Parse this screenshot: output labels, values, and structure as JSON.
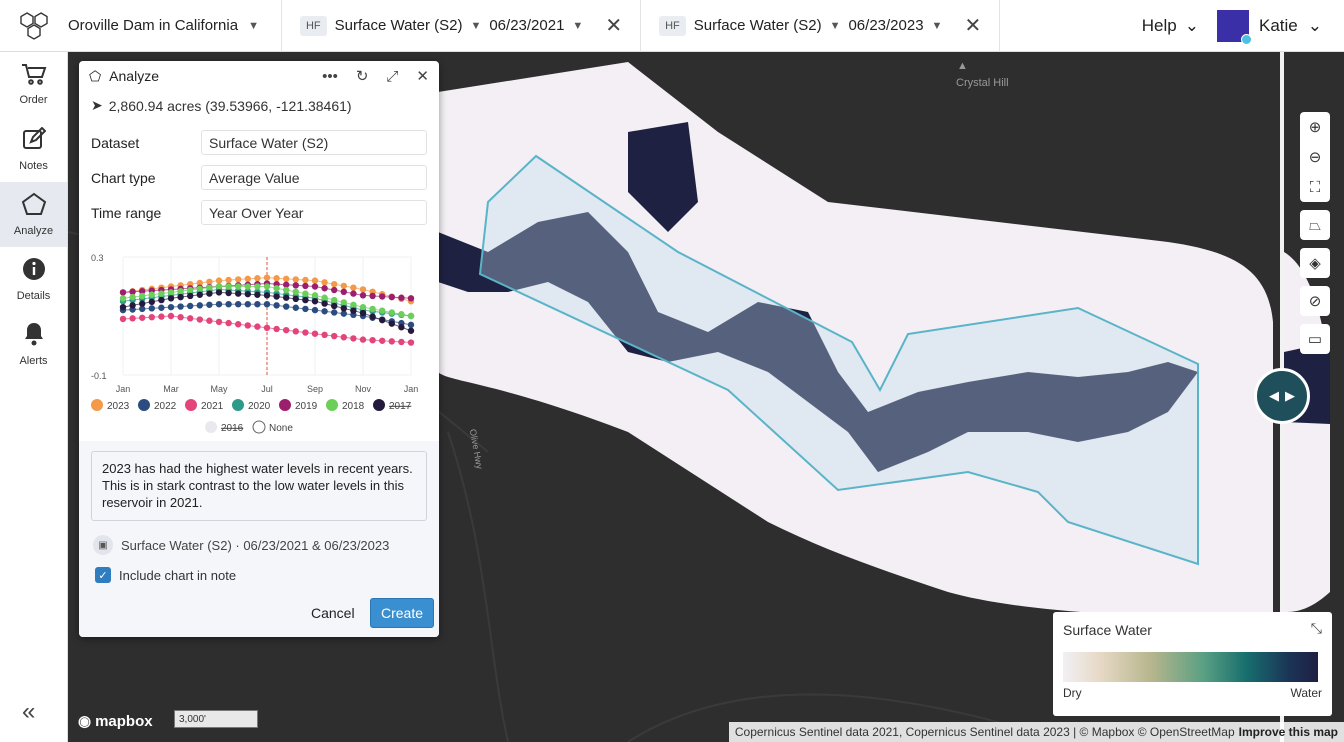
{
  "header": {
    "project": "Oroville Dam in California",
    "layers": [
      {
        "badge": "HF",
        "name": "Surface Water (S2)",
        "date": "06/23/2021"
      },
      {
        "badge": "HF",
        "name": "Surface Water (S2)",
        "date": "06/23/2023"
      }
    ],
    "help": "Help",
    "user": "Katie"
  },
  "nav": {
    "items": [
      {
        "label": "Order",
        "icon": "cart-icon"
      },
      {
        "label": "Notes",
        "icon": "edit-icon"
      },
      {
        "label": "Analyze",
        "icon": "pentagon-icon"
      },
      {
        "label": "Details",
        "icon": "info-icon"
      },
      {
        "label": "Alerts",
        "icon": "bell-icon"
      }
    ]
  },
  "panel": {
    "title": "Analyze",
    "area": "2,860.94 acres (39.53966, -121.38461)",
    "fields": [
      {
        "label": "Dataset",
        "value": "Surface Water (S2)"
      },
      {
        "label": "Chart type",
        "value": "Average Value"
      },
      {
        "label": "Time range",
        "value": "Year Over Year"
      }
    ],
    "note_text": "2023 has had the highest water levels in recent years. This is in stark contrast to the low water levels in this reservoir in 2021.",
    "source": "Surface Water (S2) · 06/23/2021 & 06/23/2023",
    "include_label": "Include chart in note",
    "cancel": "Cancel",
    "create": "Create"
  },
  "chart_data": {
    "type": "line",
    "x": [
      "Jan",
      "Mar",
      "May",
      "Jul",
      "Sep",
      "Nov",
      "Jan"
    ],
    "ylim": [
      -0.1,
      0.3
    ],
    "yticks": [
      "0.3",
      "-0.1"
    ],
    "series": [
      {
        "name": "2023",
        "color": "#f2994a",
        "values": [
          0.18,
          0.2,
          0.22,
          0.23,
          0.22,
          0.19,
          0.15
        ]
      },
      {
        "name": "2022",
        "color": "#2b4c7e",
        "values": [
          0.12,
          0.13,
          0.14,
          0.14,
          0.12,
          0.1,
          0.07
        ]
      },
      {
        "name": "2021",
        "color": "#e3447c",
        "values": [
          0.09,
          0.1,
          0.08,
          0.06,
          0.04,
          0.02,
          0.01
        ]
      },
      {
        "name": "2020",
        "color": "#2e9a8a",
        "values": [
          0.15,
          0.17,
          0.19,
          0.18,
          0.16,
          0.12,
          0.1
        ]
      },
      {
        "name": "2019",
        "color": "#9c1f6e",
        "values": [
          0.18,
          0.19,
          0.2,
          0.21,
          0.2,
          0.17,
          0.16
        ]
      },
      {
        "name": "2018",
        "color": "#6ccf5a",
        "values": [
          0.16,
          0.18,
          0.2,
          0.2,
          0.17,
          0.13,
          0.1
        ]
      },
      {
        "name": "2017",
        "color": "#241a3d",
        "values": [
          0.13,
          0.16,
          0.18,
          0.17,
          0.15,
          0.11,
          0.05
        ]
      }
    ],
    "legend": [
      {
        "name": "2023",
        "color": "#f2994a",
        "enabled": true
      },
      {
        "name": "2022",
        "color": "#2b4c7e",
        "enabled": true
      },
      {
        "name": "2021",
        "color": "#e3447c",
        "enabled": true
      },
      {
        "name": "2020",
        "color": "#2e9a8a",
        "enabled": true
      },
      {
        "name": "2019",
        "color": "#9c1f6e",
        "enabled": true
      },
      {
        "name": "2018",
        "color": "#6ccf5a",
        "enabled": true
      },
      {
        "name": "2017",
        "color": "#241a3d",
        "enabled": false
      },
      {
        "name": "2016",
        "color": "#e8e8ee",
        "enabled": false
      },
      {
        "name": "None",
        "color": "#ffffff",
        "enabled": true
      }
    ],
    "marker_month": "Jul"
  },
  "map": {
    "labels": [
      "Crystal Hill",
      "Olive Hwy"
    ],
    "legend_title": "Surface Water",
    "legend_min": "Dry",
    "legend_max": "Water",
    "scale": "3,000'",
    "mapbox": "mapbox",
    "attribution": "Copernicus Sentinel data 2021, Copernicus Sentinel data 2023 | © Mapbox © OpenStreetMap",
    "improve": "Improve this map"
  }
}
